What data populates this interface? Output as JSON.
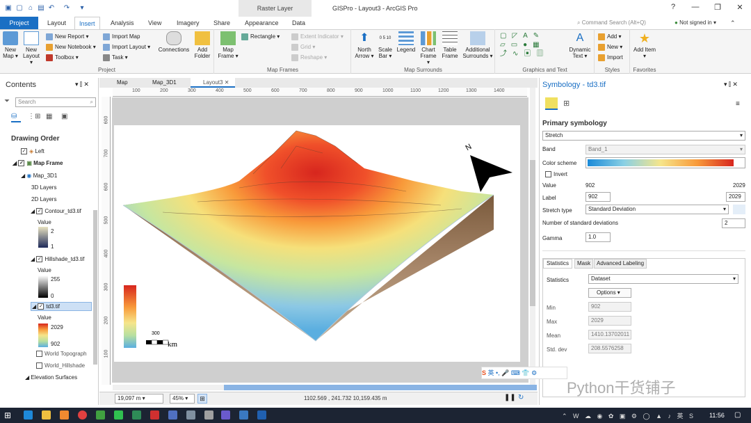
{
  "app": {
    "title": "GISPro - Layout3 - ArcGIS Pro",
    "context_tab": "Raster Layer",
    "signin": "Not signed in",
    "command_search": "Command Search (Alt+Q)"
  },
  "tabs": [
    "Project",
    "Layout",
    "Insert",
    "Analysis",
    "View",
    "Imagery",
    "Share",
    "Appearance",
    "Data"
  ],
  "ribbon": {
    "project": {
      "new_map": "New Map",
      "new_layout": "New Layout",
      "new_report": "New Report",
      "new_notebook": "New Notebook",
      "toolbox": "Toolbox",
      "import_map": "Import Map",
      "import_layout": "Import Layout",
      "task": "Task",
      "connections": "Connections",
      "add_folder": "Add Folder",
      "group": "Project"
    },
    "mapframes": {
      "map_frame": "Map Frame",
      "rectangle": "Rectangle",
      "extent_indicator": "Extent Indicator",
      "grid": "Grid",
      "reshape": "Reshape",
      "group": "Map Frames"
    },
    "surrounds": {
      "north_arrow": "North Arrow",
      "scale_bar": "Scale Bar",
      "legend": "Legend",
      "chart_frame": "Chart Frame",
      "table_frame": "Table Frame",
      "additional": "Additional Surrounds",
      "group": "Map Surrounds",
      "scale_nums": "0 5 10"
    },
    "graphics": {
      "group": "Graphics and Text",
      "dynamic_text": "Dynamic Text"
    },
    "styles": {
      "add": "Add",
      "new": "New",
      "import": "Import",
      "group": "Styles"
    },
    "favorites": {
      "add_item": "Add Item",
      "group": "Favorites"
    }
  },
  "contents": {
    "title": "Contents",
    "search_placeholder": "Search",
    "drawing_order": "Drawing Order",
    "items": {
      "left": "Left",
      "map_frame": "Map Frame",
      "map3d": "Map_3D1",
      "layers3d": "3D Layers",
      "layers2d": "2D Layers",
      "contour": "Contour_td3.tif",
      "value": "Value",
      "contour_hi": "2",
      "contour_lo": "1",
      "hillshade": "Hillshade_td3.tif",
      "hill_hi": "255",
      "hill_lo": "0",
      "td3": "td3.tif",
      "td3_hi": "2029",
      "td3_lo": "902",
      "topo": "World Topograph",
      "hillshade_world": "World_Hillshade",
      "elev": "Elevation Surfaces"
    }
  },
  "doc_tabs": [
    "Map",
    "Map_3D1",
    "Layout3"
  ],
  "ruler_h": [
    "100",
    "200",
    "300",
    "400",
    "500",
    "600",
    "700",
    "800",
    "900",
    "1000",
    "1100",
    "1200",
    "1300",
    "1400"
  ],
  "ruler_v": [
    "600",
    "700",
    "600",
    "500",
    "400",
    "300",
    "200",
    "100"
  ],
  "layout": {
    "scale_label": "300",
    "scale_unit": "km",
    "north": "N"
  },
  "status": {
    "scale": "19,097 m",
    "zoom": "45%",
    "coords": "1102.569 , 241.732  10,159.435 m"
  },
  "symbology": {
    "title": "Symbology - td3.tif",
    "primary": "Primary symbology",
    "renderer": "Stretch",
    "band_label": "Band",
    "band": "Band_1",
    "color_scheme_label": "Color scheme",
    "invert": "Invert",
    "value_label": "Value",
    "value_min": "902",
    "value_max": "2029",
    "label_label": "Label",
    "label_min": "902",
    "label_max": "2029",
    "stretch_type_label": "Stretch type",
    "stretch_type": "Standard Deviation",
    "nsd_label": "Number of standard deviations",
    "nsd": "2",
    "gamma_label": "Gamma",
    "gamma": "1.0",
    "subtabs": [
      "Statistics",
      "Mask",
      "Advanced Labeling"
    ],
    "stats_label": "Statistics",
    "stats_value": "Dataset",
    "options": "Options",
    "min_label": "Min",
    "min": "902",
    "max_label": "Max",
    "max": "2029",
    "mean_label": "Mean",
    "mean": "1410.13702011",
    "std_label": "Std. dev",
    "std": "208.5576258"
  },
  "watermark": "Python干货铺子",
  "ime": "英",
  "clock": "11:56"
}
